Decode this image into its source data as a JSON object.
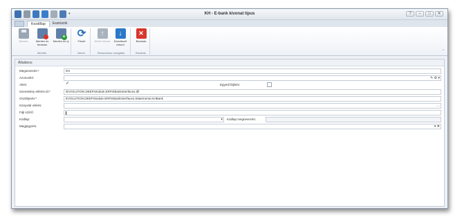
{
  "window": {
    "title": "KH - E-bank kivonat típus",
    "controls": {
      "help": "?",
      "minimize": "–",
      "maximize": "□",
      "close": "✕"
    }
  },
  "tabs": [
    {
      "label": "Kezdőlap",
      "active": true
    },
    {
      "label": "Eszközök",
      "active": false
    }
  ],
  "ribbon": {
    "groups": [
      {
        "label": "Mentés",
        "buttons": [
          {
            "label": "Mentés",
            "icon": "save-icon",
            "disabled": true
          },
          {
            "label": "Mentés és bezárás",
            "icon": "save-close-icon",
            "disabled": false
          },
          {
            "label": "Mentés és új",
            "icon": "save-new-icon",
            "disabled": false
          }
        ]
      },
      {
        "label": "Nézet",
        "buttons": [
          {
            "label": "Frissít",
            "icon": "refresh-icon",
            "disabled": false
          }
        ]
      },
      {
        "label": "Rekordokon navigálás",
        "buttons": [
          {
            "label": "Előző rekord",
            "icon": "arrow-up-icon",
            "disabled": true
          },
          {
            "label": "Következő rekord",
            "icon": "arrow-down-icon",
            "disabled": false
          }
        ]
      },
      {
        "label": "Bezárás",
        "buttons": [
          {
            "label": "Bezárás",
            "icon": "close-icon",
            "disabled": false
          }
        ]
      }
    ]
  },
  "form": {
    "section_title": "Általános",
    "fields": {
      "megnevezes": {
        "label": "Megnevezés:*",
        "value": "KH"
      },
      "azonosito": {
        "label": "Azonosító:",
        "value": ""
      },
      "aktiv": {
        "label": "Aktív:",
        "checked": true
      },
      "egyedi_fajlnev": {
        "label": "Egyedi fájlnév:",
        "checked": false
      },
      "szerelveny": {
        "label": "Szerelvény elérési út:*",
        "value": "\\EVOLUTION.DEEP.Module.ERP.EBankInterfaces.dll"
      },
      "osztalynev": {
        "label": "Osztálynév:*",
        "value": "EVOLUTION.DEEP.Module.ERP.EBankInterfaces.Statements.KHBank"
      },
      "konyvtar": {
        "label": "Könyvtár elérés:",
        "value": ""
      },
      "fajl_szuro": {
        "label": "Fájl szűrő:",
        "value": ""
      },
      "kodlap": {
        "label": "Kódlap:",
        "value": ""
      },
      "kodlap_megnevezes": {
        "label": "Kódlap megnevezés:",
        "value": ""
      },
      "megjegyzes": {
        "label": "Megjegyzés:",
        "value": ""
      }
    },
    "glyphs": {
      "check": "✓",
      "dropdown": "▾",
      "ellipsis": "…",
      "clear": "✕",
      "edit": "✎"
    }
  }
}
